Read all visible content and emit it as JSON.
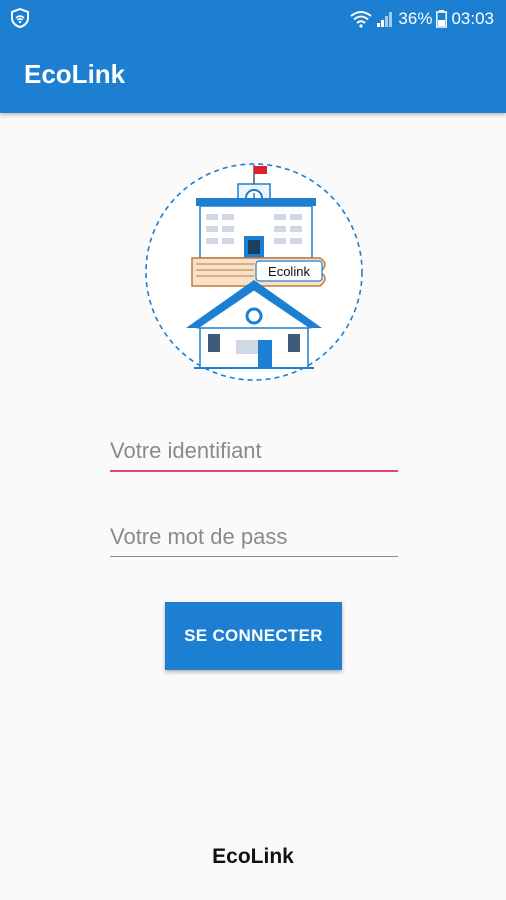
{
  "status_bar": {
    "battery_percent": "36%",
    "time": "03:03",
    "icons": [
      "shield-icon",
      "wifi-icon",
      "signal-icon",
      "battery-icon"
    ]
  },
  "app_bar": {
    "title": "EcoLink"
  },
  "logo": {
    "text": "Ecolink"
  },
  "login": {
    "username_placeholder": "Votre identifiant",
    "password_placeholder": "Votre mot de pass",
    "submit_label": "SE CONNECTER"
  },
  "footer": {
    "text": "EcoLink"
  },
  "colors": {
    "primary": "#1d7fd1",
    "accent": "#e0457b",
    "background": "#fafafa"
  }
}
